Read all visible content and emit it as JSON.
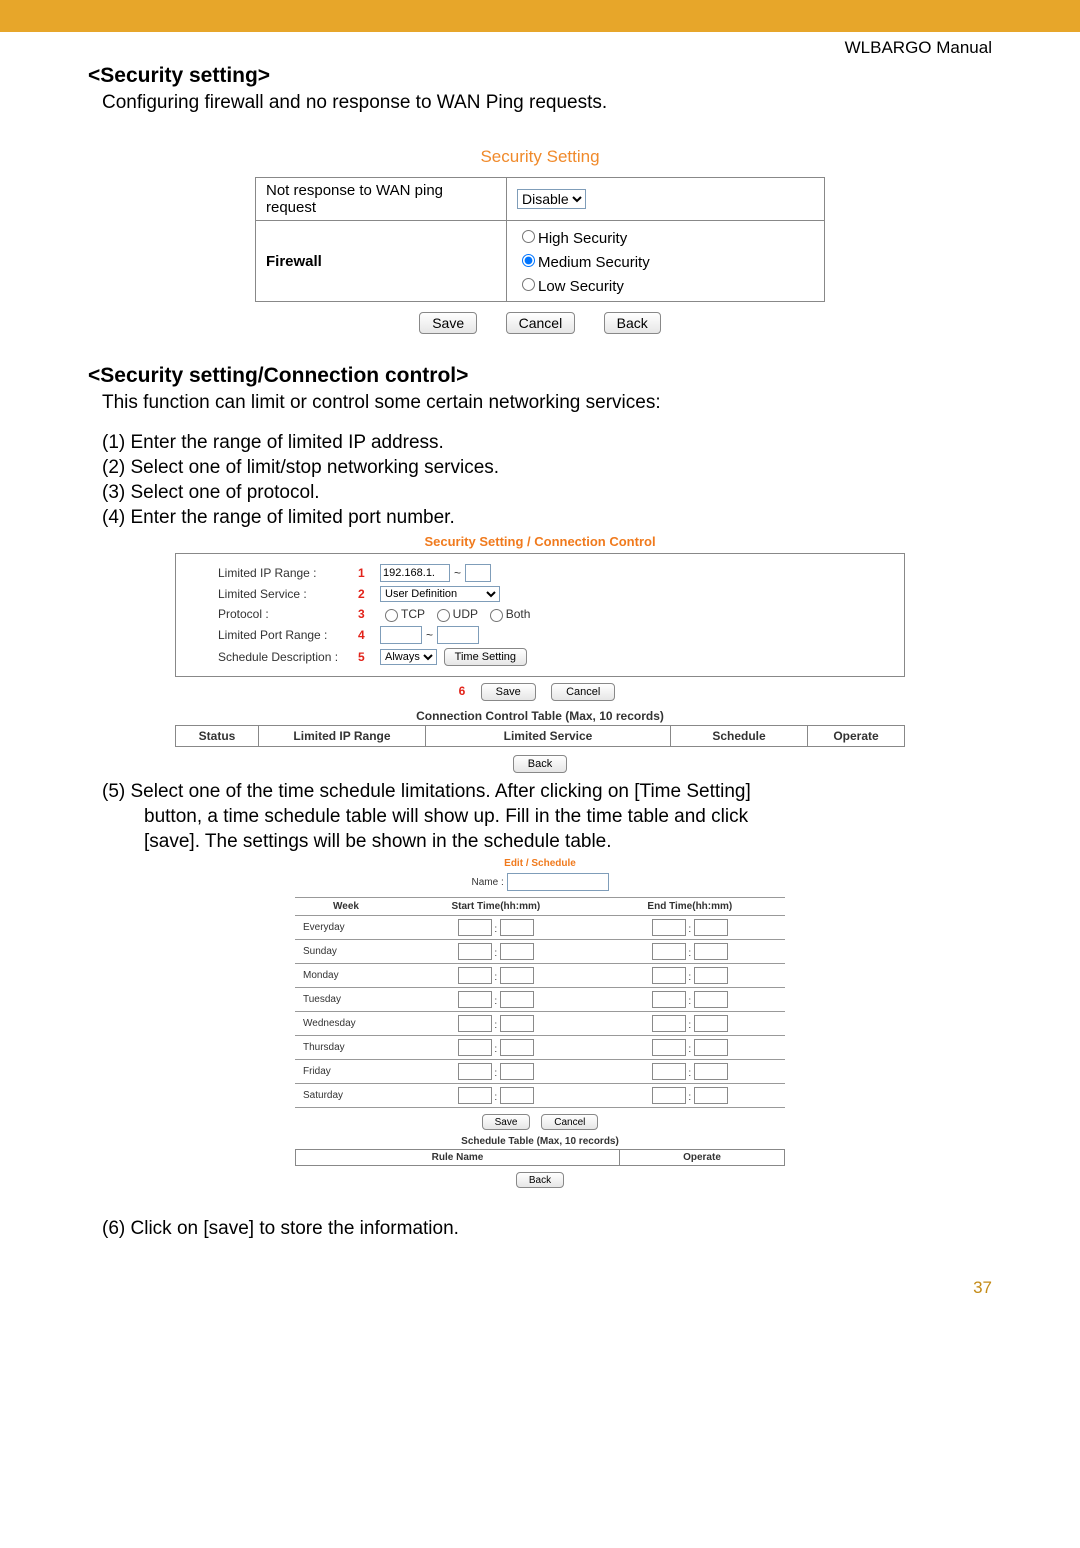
{
  "header": {
    "manual_name": "WLBARGO Manual",
    "page_number": "37"
  },
  "section1": {
    "title": "<Security setting>",
    "intro": "Configuring firewall and no response to WAN Ping requests."
  },
  "fig_security": {
    "title": "Security Setting",
    "row_wan_label": "Not response to WAN ping request",
    "wan_select_value": "Disable",
    "row_firewall_label": "Firewall",
    "firewall_options": {
      "high": "High Security",
      "medium": "Medium Security",
      "low": "Low Security"
    },
    "buttons": {
      "save": "Save",
      "cancel": "Cancel",
      "back": "Back"
    }
  },
  "section2": {
    "title": "<Security setting/Connection control>",
    "intro": "This function can limit or control some certain networking services:",
    "steps": {
      "s1": "(1) Enter the range of limited IP address.",
      "s2": "(2) Select one of limit/stop networking services.",
      "s3": "(3) Select one of protocol.",
      "s4": "(4) Enter the range of limited port number.",
      "s5a": "(5) Select one of the time schedule limitations.  After clicking on [Time Setting]",
      "s5b": "button, a time schedule table will show up. Fill in the time table and click",
      "s5c": "[save]. The settings will be shown in the schedule table.",
      "s6": "(6) Click on [save] to store the information."
    }
  },
  "fig_conn": {
    "title": "Security Setting / Connection Control",
    "labels": {
      "ip": "Limited IP Range :",
      "svc": "Limited Service :",
      "proto": "Protocol :",
      "port": "Limited Port Range :",
      "sched": "Schedule Description :"
    },
    "markers": {
      "m1": "1",
      "m2": "2",
      "m3": "3",
      "m4": "4",
      "m5": "5",
      "m6": "6"
    },
    "ip_prefix": "192.168.1.",
    "svc_value": "User Definition",
    "proto": {
      "tcp": "TCP",
      "udp": "UDP",
      "both": "Both"
    },
    "sched_value": "Always",
    "time_setting_btn": "Time Setting",
    "buttons": {
      "save": "Save",
      "cancel": "Cancel",
      "back": "Back"
    },
    "table_caption": "Connection Control Table (Max, 10 records)",
    "cols": {
      "status": "Status",
      "ip": "Limited IP Range",
      "svc": "Limited Service",
      "sched": "Schedule",
      "op": "Operate"
    }
  },
  "fig_sched": {
    "title": "Edit / Schedule",
    "name_label": "Name :",
    "cols": {
      "week": "Week",
      "start": "Start Time(hh:mm)",
      "end": "End Time(hh:mm)"
    },
    "days": {
      "d1": "Everyday",
      "d2": "Sunday",
      "d3": "Monday",
      "d4": "Tuesday",
      "d5": "Wednesday",
      "d6": "Thursday",
      "d7": "Friday",
      "d8": "Saturday"
    },
    "buttons": {
      "save": "Save",
      "cancel": "Cancel",
      "back": "Back"
    },
    "table_caption": "Schedule Table (Max, 10 records)",
    "table_cols": {
      "rn": "Rule Name",
      "op": "Operate"
    }
  }
}
